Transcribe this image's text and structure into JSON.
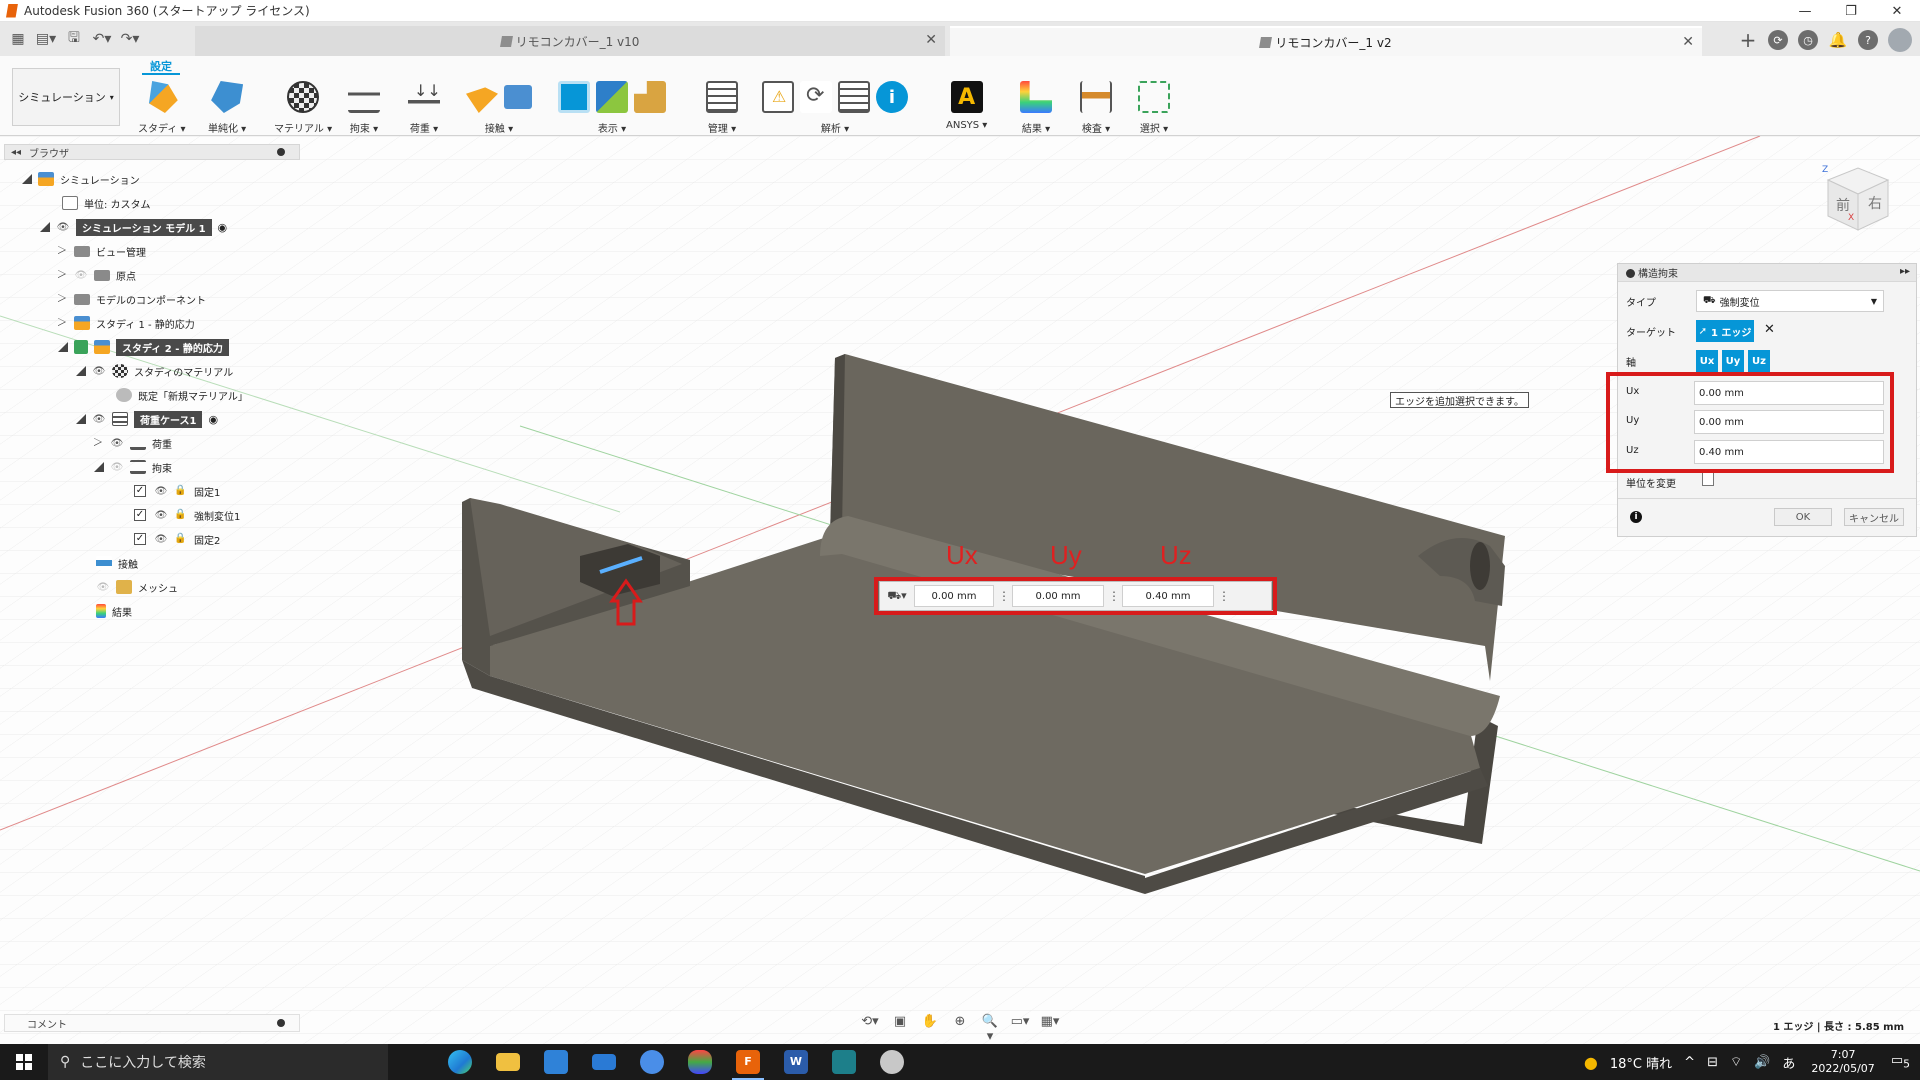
{
  "window": {
    "title": "Autodesk Fusion 360 (スタートアップ ライセンス)",
    "min": "—",
    "max": "❐",
    "close": "✕"
  },
  "tabs": [
    {
      "label": "リモコンカバー_1 v10"
    },
    {
      "label": "リモコンカバー_1 v2"
    }
  ],
  "ribbon": {
    "workspace_tab": "設定",
    "workspace": "シミュレーション",
    "groups": [
      {
        "label": "スタディ ▾"
      },
      {
        "label": "単純化 ▾"
      },
      {
        "label": "マテリアル ▾"
      },
      {
        "label": "拘束 ▾"
      },
      {
        "label": "荷重 ▾"
      },
      {
        "label": "接触 ▾"
      },
      {
        "label": "表示 ▾"
      },
      {
        "label": "管理 ▾"
      },
      {
        "label": "解析 ▾"
      },
      {
        "label": "ANSYS ▾"
      },
      {
        "label": "結果 ▾"
      },
      {
        "label": "検査 ▾"
      },
      {
        "label": "選択 ▾"
      }
    ]
  },
  "browser": {
    "title": "ブラウザ",
    "items": [
      {
        "label": "シミュレーション"
      },
      {
        "label": "単位: カスタム"
      },
      {
        "label": "シミュレーション モデル 1"
      },
      {
        "label": "ビュー管理"
      },
      {
        "label": "原点"
      },
      {
        "label": "モデルのコンポーネント"
      },
      {
        "label": "スタディ 1 - 静的応力"
      },
      {
        "label": "スタディ 2 - 静的応力"
      },
      {
        "label": "スタディのマテリアル"
      },
      {
        "label": "既定「新規マテリアル」"
      },
      {
        "label": "荷重ケース1"
      },
      {
        "label": "荷重"
      },
      {
        "label": "拘束"
      },
      {
        "label": "固定1"
      },
      {
        "label": "強制変位1"
      },
      {
        "label": "固定2"
      },
      {
        "label": "接触"
      },
      {
        "label": "メッシュ"
      },
      {
        "label": "結果"
      }
    ]
  },
  "comments": {
    "label": "コメント"
  },
  "panel": {
    "title": "構造拘束",
    "type_label": "タイプ",
    "type_value": "強制変位",
    "target_label": "ターゲット",
    "target_value": "1 エッジ",
    "axis_label": "軸",
    "axes": [
      "Ux",
      "Uy",
      "Uz"
    ],
    "fields": [
      {
        "label": "Ux",
        "value": "0.00 mm"
      },
      {
        "label": "Uy",
        "value": "0.00 mm"
      },
      {
        "label": "Uz",
        "value": "0.40 mm"
      }
    ],
    "units_label": "単位を変更",
    "ok": "OK",
    "cancel": "キャンセル"
  },
  "hud": {
    "labels": [
      "Ux",
      "Uy",
      "Uz"
    ],
    "values": [
      "0.00 mm",
      "0.00 mm",
      "0.40 mm"
    ]
  },
  "tooltip": "エッジを追加選択できます。",
  "viewcube": {
    "front": "前",
    "right": "右",
    "axis_z": "Z",
    "axis_x": "X"
  },
  "status": "1 エッジ | 長さ : 5.85 mm",
  "taskbar": {
    "search_placeholder": "ここに入力して検索",
    "weather": "18°C 晴れ",
    "time": "7:07",
    "date": "2022/05/07",
    "ime": "あ",
    "notify_count": "5"
  },
  "colors": {
    "accent": "#0696d7",
    "highlight_red": "#d81b1b",
    "model": "#6f6b62"
  }
}
